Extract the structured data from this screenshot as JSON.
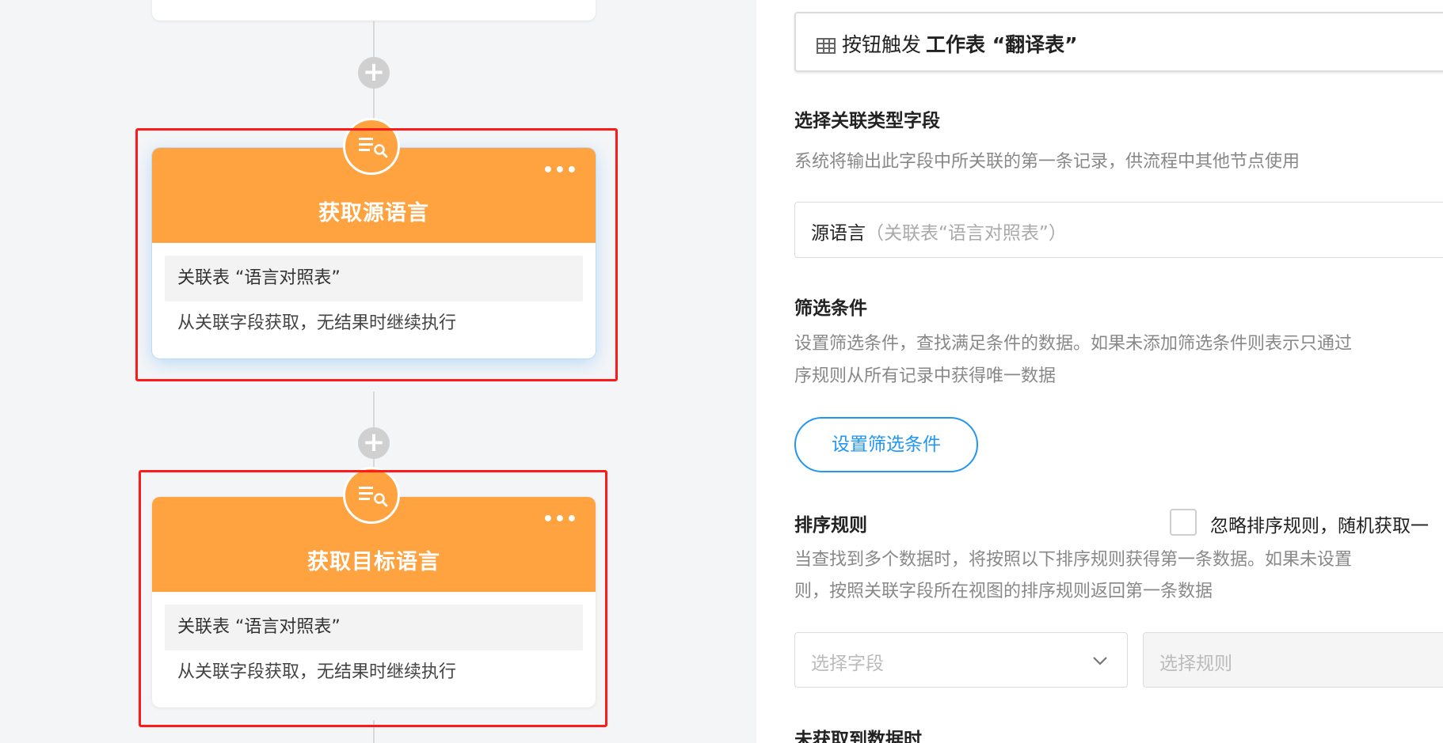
{
  "workflow": {
    "nodes": [
      {
        "title": "获取源语言",
        "relation": "关联表 “语言对照表”",
        "description": "从关联字段获取，无结果时继续执行",
        "more": "•••",
        "icon": "search-list-icon"
      },
      {
        "title": "获取目标语言",
        "relation": "关联表 “语言对照表”",
        "description": "从关联字段获取，无结果时继续执行",
        "more": "•••",
        "icon": "search-list-icon"
      }
    ],
    "add_symbol": "+",
    "colors": {
      "node_header": "#ffa340",
      "highlight": "#ff1a1a",
      "canvas_bg": "#f4f5f7"
    }
  },
  "panel": {
    "trigger": {
      "prefix": "按钮触发",
      "bold": "工作表 “翻译表”",
      "icon": "table-icon"
    },
    "relation_field": {
      "title": "选择关联类型字段",
      "description": "系统将输出此字段中所关联的第一条记录，供流程中其他节点使用",
      "value": "源语言",
      "hint": "（关联表“语言对照表”）"
    },
    "filter": {
      "title": "筛选条件",
      "description_line1": "设置筛选条件，查找满足条件的数据。如果未添加筛选条件则表示只通过",
      "description_line2": "序规则从所有记录中获得唯一数据",
      "button": "设置筛选条件"
    },
    "sort": {
      "title": "排序规则",
      "checkbox_label": "忽略排序规则，随机获取一",
      "description_line1": "当查找到多个数据时，将按照以下排序规则获得第一条数据。如果未设置",
      "description_line2": "则，按照关联字段所在视图的排序规则返回第一条数据",
      "field_placeholder": "选择字段",
      "rule_placeholder": "选择规则"
    },
    "no_data": {
      "title": "未获取到数据时"
    },
    "colors": {
      "accent": "#2196f3"
    }
  }
}
